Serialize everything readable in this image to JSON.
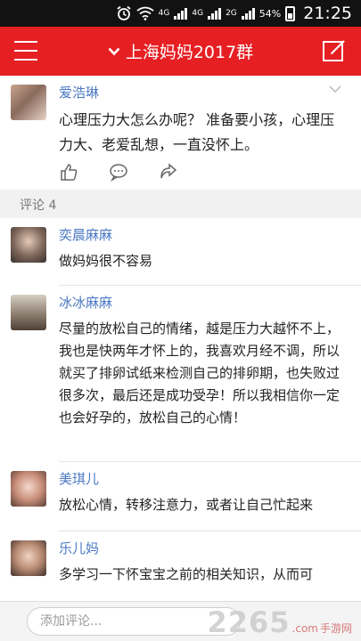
{
  "status_bar": {
    "network_1": "4G",
    "network_2": "4G",
    "network_3": "2G",
    "battery": "54%",
    "time": "21:25"
  },
  "header": {
    "title": "上海妈妈2017群",
    "menu_icon": "hamburger-icon",
    "edit_icon": "edit-icon",
    "background": "#e61f23"
  },
  "post": {
    "author": "爱浩琳",
    "text": "心理压力大怎么办呢？ 准备要小孩，心理压力大、老爱乱想，一直没怀上。"
  },
  "comments_header": "评论 4",
  "comments": [
    {
      "name": "奕晨麻麻",
      "text": "做妈妈很不容易"
    },
    {
      "name": "冰冰麻麻",
      "text": "尽量的放松自己的情绪，越是压力大越怀不上，我也是快两年才怀上的，我喜欢月经不调，所以就买了排卵试纸来检测自己的排卵期，也失败过很多次，最后还是成功受孕！所以我相信你一定也会好孕的，放松自己的心情！"
    },
    {
      "name": "美琪儿",
      "text": "放松心情，转移注意力，或者让自己忙起来"
    },
    {
      "name": "乐儿妈",
      "text": "多学习一下怀宝宝之前的相关知识，从而可"
    }
  ],
  "comment_input": {
    "placeholder": "添加评论..."
  },
  "watermark": {
    "main": "2265",
    "sub": ".com",
    "label": "手游网"
  }
}
